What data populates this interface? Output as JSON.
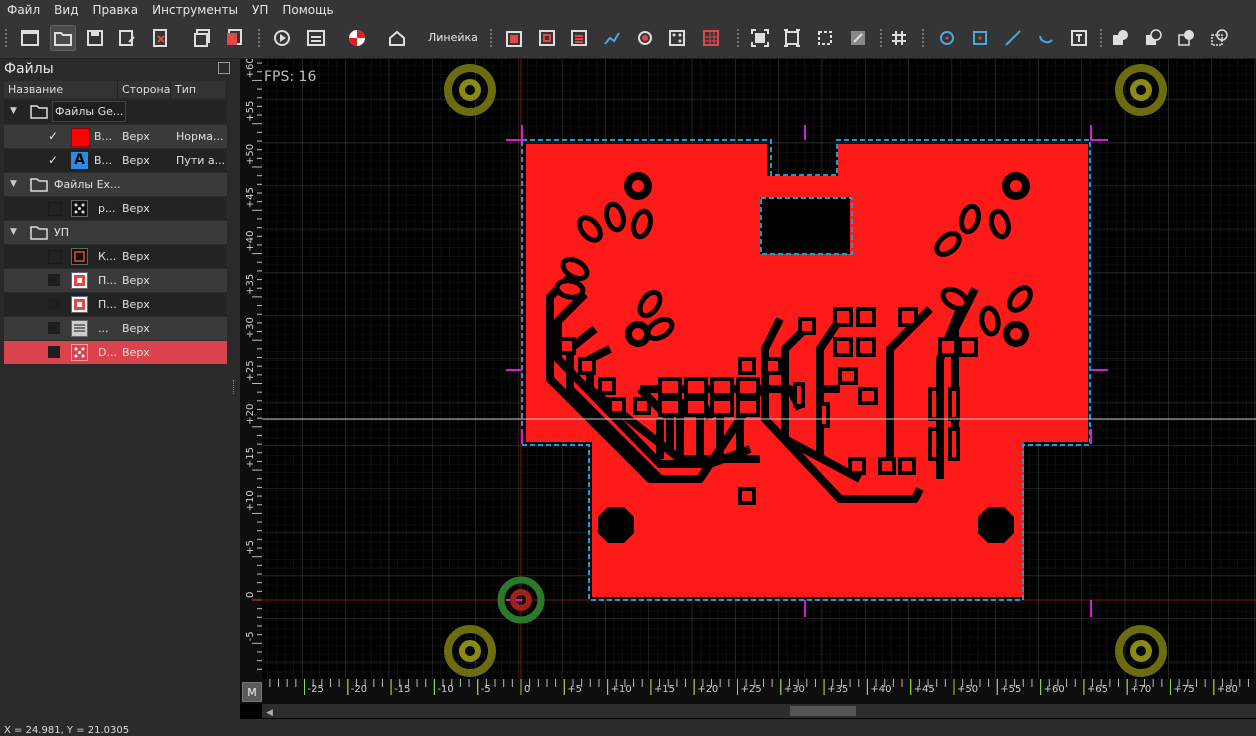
{
  "menu": [
    "Файл",
    "Вид",
    "Правка",
    "Инструменты",
    "УП",
    "Помощь"
  ],
  "toolbar": {
    "ruler_label": "Линейка"
  },
  "panel": {
    "title": "Файлы",
    "columns": [
      "Название",
      "Сторона",
      "Тип"
    ],
    "rows": [
      {
        "kind": "group",
        "label": "Файлы Ge..."
      },
      {
        "kind": "item",
        "name": "В...",
        "side": "Верх",
        "type": "Норма...",
        "checked": "✓"
      },
      {
        "kind": "item",
        "name": "В...",
        "side": "Верх",
        "type": "Пути а...",
        "checked": "✓"
      },
      {
        "kind": "group",
        "label": "Файлы Ex..."
      },
      {
        "kind": "item",
        "name": "р...",
        "side": "Верх",
        "type": "",
        "checked": ""
      },
      {
        "kind": "group",
        "label": "УП"
      },
      {
        "kind": "item",
        "name": "К...",
        "side": "Верх",
        "type": "",
        "checked": ""
      },
      {
        "kind": "item",
        "name": "П...",
        "side": "Верх",
        "type": "",
        "checked": ""
      },
      {
        "kind": "item",
        "name": "П...",
        "side": "Верх",
        "type": "",
        "checked": ""
      },
      {
        "kind": "item",
        "name": "...",
        "side": "Верх",
        "type": "",
        "checked": ""
      },
      {
        "kind": "item",
        "name": "D...",
        "side": "Верх",
        "type": "",
        "checked": ""
      }
    ],
    "text_icon": "A"
  },
  "canvas": {
    "fps": "FPS: 16",
    "x_ticks": [
      "-25",
      "-20",
      "-15",
      "-10",
      "-5",
      "0",
      "+5",
      "+10",
      "+15",
      "+20",
      "+25",
      "+30",
      "+35",
      "+40",
      "+45",
      "+50",
      "+55",
      "+60",
      "+65",
      "+70",
      "+75",
      "+80"
    ],
    "y_ticks": [
      "+60",
      "+55",
      "+50",
      "+45",
      "+40",
      "+35",
      "+30",
      "+25",
      "+20",
      "+15",
      "+10",
      "+5",
      "0",
      "-5"
    ],
    "corner_button": "M",
    "board_color": "#ff1a1a",
    "outline_color": "#1e9bd7",
    "marker_color": "#d11fd1"
  },
  "status": {
    "coords": "X = 24.981, Y = 21.0305"
  }
}
